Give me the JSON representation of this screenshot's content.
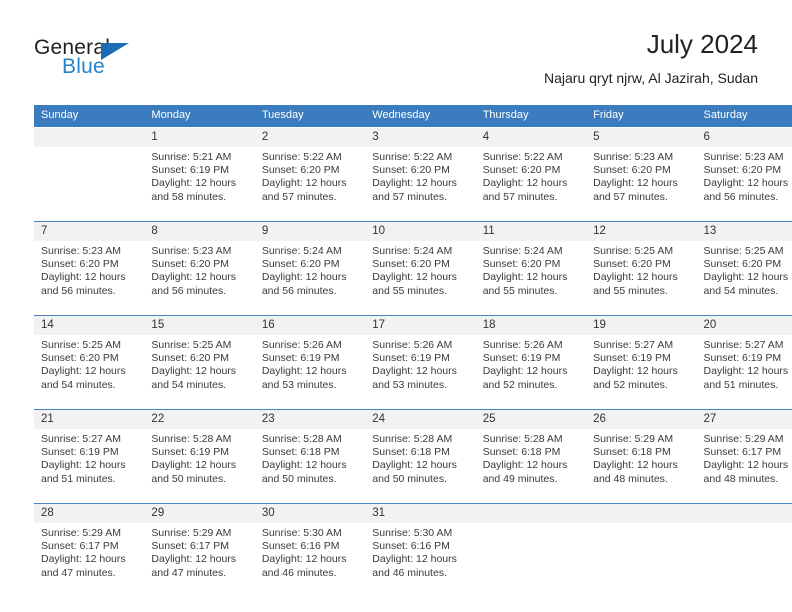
{
  "brand": {
    "name_part1": "General",
    "name_part2": "Blue",
    "triangle_icon": "triangle-icon",
    "accent_color": "#2683c6",
    "dark_color": "#231f20"
  },
  "header": {
    "title": "July 2024",
    "subtitle": "Najaru qryt njrw, Al Jazirah, Sudan"
  },
  "calendar": {
    "header_bg": "#3a7cbe",
    "daynum_bg": "#f2f2f2",
    "weekday_headers": [
      "Sunday",
      "Monday",
      "Tuesday",
      "Wednesday",
      "Thursday",
      "Friday",
      "Saturday"
    ],
    "weeks": [
      [
        {
          "day": "",
          "sunrise": "",
          "sunset": "",
          "daylight1": "",
          "daylight2": ""
        },
        {
          "day": "1",
          "sunrise": "Sunrise: 5:21 AM",
          "sunset": "Sunset: 6:19 PM",
          "daylight1": "Daylight: 12 hours",
          "daylight2": "and 58 minutes."
        },
        {
          "day": "2",
          "sunrise": "Sunrise: 5:22 AM",
          "sunset": "Sunset: 6:20 PM",
          "daylight1": "Daylight: 12 hours",
          "daylight2": "and 57 minutes."
        },
        {
          "day": "3",
          "sunrise": "Sunrise: 5:22 AM",
          "sunset": "Sunset: 6:20 PM",
          "daylight1": "Daylight: 12 hours",
          "daylight2": "and 57 minutes."
        },
        {
          "day": "4",
          "sunrise": "Sunrise: 5:22 AM",
          "sunset": "Sunset: 6:20 PM",
          "daylight1": "Daylight: 12 hours",
          "daylight2": "and 57 minutes."
        },
        {
          "day": "5",
          "sunrise": "Sunrise: 5:23 AM",
          "sunset": "Sunset: 6:20 PM",
          "daylight1": "Daylight: 12 hours",
          "daylight2": "and 57 minutes."
        },
        {
          "day": "6",
          "sunrise": "Sunrise: 5:23 AM",
          "sunset": "Sunset: 6:20 PM",
          "daylight1": "Daylight: 12 hours",
          "daylight2": "and 56 minutes."
        }
      ],
      [
        {
          "day": "7",
          "sunrise": "Sunrise: 5:23 AM",
          "sunset": "Sunset: 6:20 PM",
          "daylight1": "Daylight: 12 hours",
          "daylight2": "and 56 minutes."
        },
        {
          "day": "8",
          "sunrise": "Sunrise: 5:23 AM",
          "sunset": "Sunset: 6:20 PM",
          "daylight1": "Daylight: 12 hours",
          "daylight2": "and 56 minutes."
        },
        {
          "day": "9",
          "sunrise": "Sunrise: 5:24 AM",
          "sunset": "Sunset: 6:20 PM",
          "daylight1": "Daylight: 12 hours",
          "daylight2": "and 56 minutes."
        },
        {
          "day": "10",
          "sunrise": "Sunrise: 5:24 AM",
          "sunset": "Sunset: 6:20 PM",
          "daylight1": "Daylight: 12 hours",
          "daylight2": "and 55 minutes."
        },
        {
          "day": "11",
          "sunrise": "Sunrise: 5:24 AM",
          "sunset": "Sunset: 6:20 PM",
          "daylight1": "Daylight: 12 hours",
          "daylight2": "and 55 minutes."
        },
        {
          "day": "12",
          "sunrise": "Sunrise: 5:25 AM",
          "sunset": "Sunset: 6:20 PM",
          "daylight1": "Daylight: 12 hours",
          "daylight2": "and 55 minutes."
        },
        {
          "day": "13",
          "sunrise": "Sunrise: 5:25 AM",
          "sunset": "Sunset: 6:20 PM",
          "daylight1": "Daylight: 12 hours",
          "daylight2": "and 54 minutes."
        }
      ],
      [
        {
          "day": "14",
          "sunrise": "Sunrise: 5:25 AM",
          "sunset": "Sunset: 6:20 PM",
          "daylight1": "Daylight: 12 hours",
          "daylight2": "and 54 minutes."
        },
        {
          "day": "15",
          "sunrise": "Sunrise: 5:25 AM",
          "sunset": "Sunset: 6:20 PM",
          "daylight1": "Daylight: 12 hours",
          "daylight2": "and 54 minutes."
        },
        {
          "day": "16",
          "sunrise": "Sunrise: 5:26 AM",
          "sunset": "Sunset: 6:19 PM",
          "daylight1": "Daylight: 12 hours",
          "daylight2": "and 53 minutes."
        },
        {
          "day": "17",
          "sunrise": "Sunrise: 5:26 AM",
          "sunset": "Sunset: 6:19 PM",
          "daylight1": "Daylight: 12 hours",
          "daylight2": "and 53 minutes."
        },
        {
          "day": "18",
          "sunrise": "Sunrise: 5:26 AM",
          "sunset": "Sunset: 6:19 PM",
          "daylight1": "Daylight: 12 hours",
          "daylight2": "and 52 minutes."
        },
        {
          "day": "19",
          "sunrise": "Sunrise: 5:27 AM",
          "sunset": "Sunset: 6:19 PM",
          "daylight1": "Daylight: 12 hours",
          "daylight2": "and 52 minutes."
        },
        {
          "day": "20",
          "sunrise": "Sunrise: 5:27 AM",
          "sunset": "Sunset: 6:19 PM",
          "daylight1": "Daylight: 12 hours",
          "daylight2": "and 51 minutes."
        }
      ],
      [
        {
          "day": "21",
          "sunrise": "Sunrise: 5:27 AM",
          "sunset": "Sunset: 6:19 PM",
          "daylight1": "Daylight: 12 hours",
          "daylight2": "and 51 minutes."
        },
        {
          "day": "22",
          "sunrise": "Sunrise: 5:28 AM",
          "sunset": "Sunset: 6:19 PM",
          "daylight1": "Daylight: 12 hours",
          "daylight2": "and 50 minutes."
        },
        {
          "day": "23",
          "sunrise": "Sunrise: 5:28 AM",
          "sunset": "Sunset: 6:18 PM",
          "daylight1": "Daylight: 12 hours",
          "daylight2": "and 50 minutes."
        },
        {
          "day": "24",
          "sunrise": "Sunrise: 5:28 AM",
          "sunset": "Sunset: 6:18 PM",
          "daylight1": "Daylight: 12 hours",
          "daylight2": "and 50 minutes."
        },
        {
          "day": "25",
          "sunrise": "Sunrise: 5:28 AM",
          "sunset": "Sunset: 6:18 PM",
          "daylight1": "Daylight: 12 hours",
          "daylight2": "and 49 minutes."
        },
        {
          "day": "26",
          "sunrise": "Sunrise: 5:29 AM",
          "sunset": "Sunset: 6:18 PM",
          "daylight1": "Daylight: 12 hours",
          "daylight2": "and 48 minutes."
        },
        {
          "day": "27",
          "sunrise": "Sunrise: 5:29 AM",
          "sunset": "Sunset: 6:17 PM",
          "daylight1": "Daylight: 12 hours",
          "daylight2": "and 48 minutes."
        }
      ],
      [
        {
          "day": "28",
          "sunrise": "Sunrise: 5:29 AM",
          "sunset": "Sunset: 6:17 PM",
          "daylight1": "Daylight: 12 hours",
          "daylight2": "and 47 minutes."
        },
        {
          "day": "29",
          "sunrise": "Sunrise: 5:29 AM",
          "sunset": "Sunset: 6:17 PM",
          "daylight1": "Daylight: 12 hours",
          "daylight2": "and 47 minutes."
        },
        {
          "day": "30",
          "sunrise": "Sunrise: 5:30 AM",
          "sunset": "Sunset: 6:16 PM",
          "daylight1": "Daylight: 12 hours",
          "daylight2": "and 46 minutes."
        },
        {
          "day": "31",
          "sunrise": "Sunrise: 5:30 AM",
          "sunset": "Sunset: 6:16 PM",
          "daylight1": "Daylight: 12 hours",
          "daylight2": "and 46 minutes."
        },
        {
          "day": "",
          "sunrise": "",
          "sunset": "",
          "daylight1": "",
          "daylight2": ""
        },
        {
          "day": "",
          "sunrise": "",
          "sunset": "",
          "daylight1": "",
          "daylight2": ""
        },
        {
          "day": "",
          "sunrise": "",
          "sunset": "",
          "daylight1": "",
          "daylight2": ""
        }
      ]
    ]
  }
}
